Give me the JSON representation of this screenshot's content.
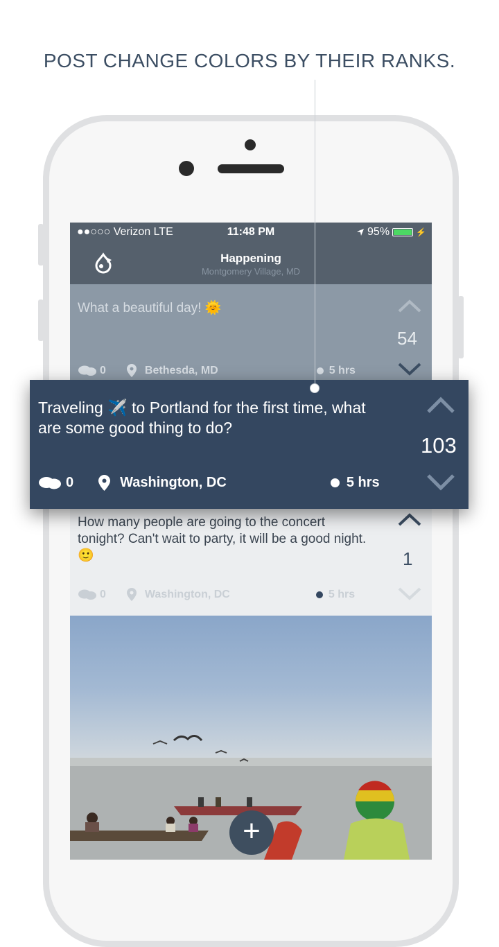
{
  "headline": "POST CHANGE COLORS BY THEIR RANKS.",
  "status_bar": {
    "carrier": "●●○○○ Verizon   LTE",
    "time": "11:48 PM",
    "battery": "95%"
  },
  "nav": {
    "title": "Happening",
    "subtitle": "Montgomery Village, MD"
  },
  "posts": [
    {
      "text": "What a beautiful day! 🌞",
      "votes": "54",
      "comments": "0",
      "location": "Bethesda, MD",
      "time": "5 hrs"
    },
    {
      "text": "Traveling ✈️ to Portland for the first time, what are some good thing to do?",
      "votes": "103",
      "comments": "0",
      "location": "Washington, DC",
      "time": "5 hrs"
    },
    {
      "text": "How many people are going to the concert tonight? Can't wait to party, it will be a good night. 🙂",
      "votes": "1",
      "comments": "0",
      "location": "Washington, DC",
      "time": "5 hrs"
    }
  ],
  "fab_label": "+",
  "colors": {
    "accent_dark": "#344760",
    "nav_bg": "#55606c",
    "post_faded": "#8c99a6",
    "battery": "#4cd964"
  }
}
